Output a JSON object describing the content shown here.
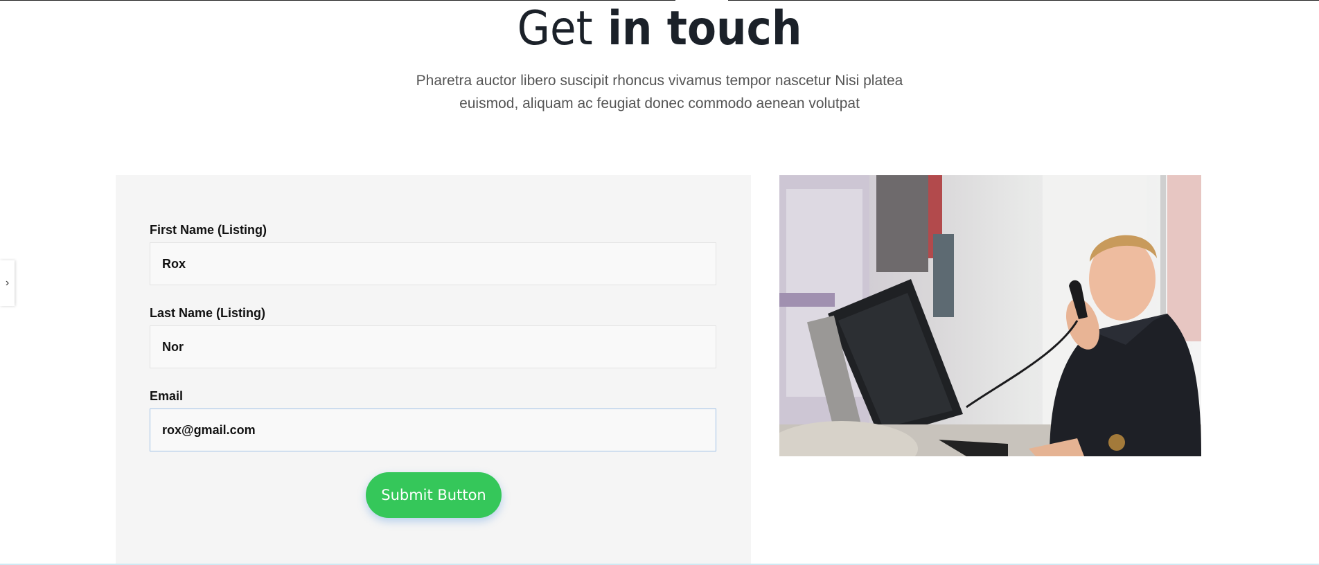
{
  "header": {
    "title_light": "Get",
    "title_bold": "in touch",
    "subtitle_line1": "Pharetra auctor libero suscipit rhoncus vivamus tempor nascetur Nisi platea",
    "subtitle_line2": "euismod, aliquam ac feugiat donec commodo aenean volutpat"
  },
  "side_tab": {
    "icon": "chevron-right-icon",
    "glyph": "›"
  },
  "form": {
    "fields": [
      {
        "label": "First Name (Listing)",
        "value": "Rox"
      },
      {
        "label": "Last Name (Listing)",
        "value": "Nor"
      },
      {
        "label": "Email",
        "value": "rox@gmail.com"
      }
    ],
    "submit_label": "Submit Button"
  },
  "photo": {
    "subject": "smiling man talking on a desk phone in an office"
  },
  "colors": {
    "accent": "#35c75a",
    "panel_bg": "#f5f5f5",
    "title": "#1b2129"
  }
}
